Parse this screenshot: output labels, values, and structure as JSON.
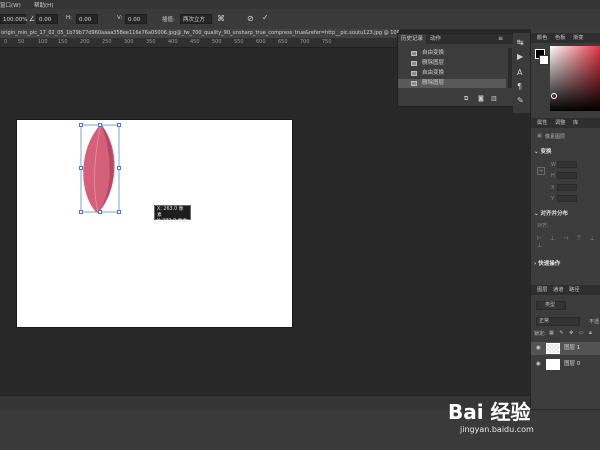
{
  "menubar": {
    "item1": "窗口(W)",
    "item2": "帮助(H)"
  },
  "options": {
    "zoom": "100.00%",
    "angle": "0.00",
    "h_label": "H:",
    "h_value": "0.00",
    "v_label": "V:",
    "v_value": "0.00",
    "interp_label": "插值:",
    "interp_value": "两次立方"
  },
  "document": {
    "tab_title": "origin_min_pic_17_02_05_1b79b77d960aaaa358ee116e76a05006.jpg@_fw_700_quality_90_unsharp_true_compress_true&refer=http__pic.soutu123.jpg @ 100% (图层",
    "ruler_ticks": [
      "0",
      "50",
      "100",
      "150",
      "200",
      "250",
      "300",
      "350",
      "400",
      "450",
      "500",
      "550",
      "600",
      "650",
      "700",
      "750"
    ],
    "transform_tooltip": {
      "line1": "X: 263.0 像素",
      "line2": "Y: 232.0 像素"
    }
  },
  "history_panel": {
    "tab_history": "历史记录",
    "tab_actions": "动作",
    "items": [
      "自由变换",
      "删除图层",
      "自由变换",
      "删除图层"
    ]
  },
  "right_panels": {
    "color_tabs": [
      "颜色",
      "色板",
      "渐变"
    ],
    "props_tabs": [
      "属性",
      "调整",
      "库"
    ],
    "props_title": "像素图层",
    "transform_title": "变换",
    "transform_fields": [
      "W",
      "H",
      "X",
      "Y"
    ],
    "align_title": "对齐并分布",
    "align_sub": "对齐:",
    "quick_title": "快速操作",
    "layers_tabs": [
      "图层",
      "通道",
      "路径"
    ],
    "layer_filter": "类型",
    "blend_mode": "正常",
    "opacity_label": "不透",
    "lock_label": "锁定:",
    "layers": [
      {
        "name": "图层 1",
        "selected": true
      },
      {
        "name": "图层 0",
        "selected": false
      }
    ]
  },
  "watermark": {
    "logo": "Bai  经验",
    "url": "jingyan.baidu.com"
  },
  "colors": {
    "accent": "#4a78c8",
    "petal": "#d4607a",
    "petal_dark": "#b64864"
  }
}
